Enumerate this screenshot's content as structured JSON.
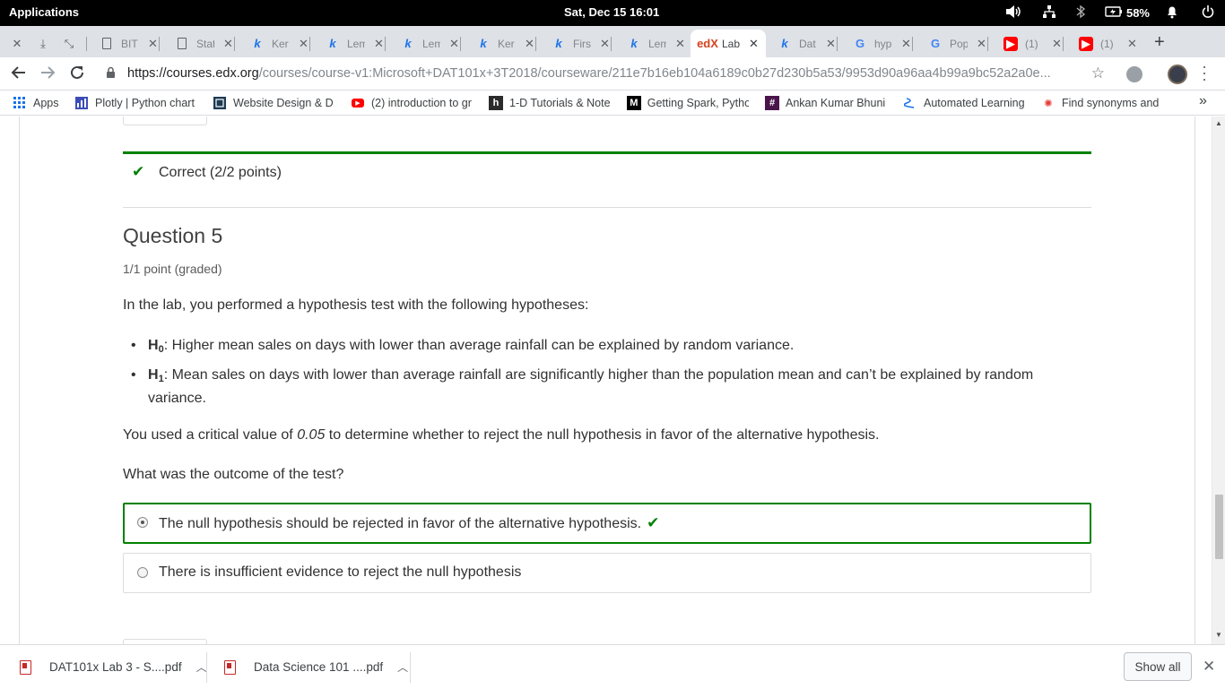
{
  "system": {
    "apps_label": "Applications",
    "clock": "Sat, Dec 15   16:01",
    "battery": "58%",
    "icons": [
      "volume-icon",
      "network-icon",
      "bluetooth-icon",
      "battery-icon",
      "bell-icon",
      "power-icon"
    ]
  },
  "tabs": [
    {
      "icon": "close-icon",
      "label": ""
    },
    {
      "icon": "download-icon",
      "label": ""
    },
    {
      "icon": "collapse-icon",
      "label": ""
    },
    {
      "icon": "doc-icon",
      "label": "BIT"
    },
    {
      "icon": "doc-icon",
      "label": "Stat"
    },
    {
      "icon": "k-icon",
      "label": "Ker"
    },
    {
      "icon": "k-icon",
      "label": "Lem"
    },
    {
      "icon": "k-icon",
      "label": "Lem"
    },
    {
      "icon": "k-icon",
      "label": "Ker"
    },
    {
      "icon": "k-icon",
      "label": "Firs"
    },
    {
      "icon": "k-icon",
      "label": "Lem"
    },
    {
      "icon": "edx-icon",
      "label": "Lab",
      "active": true
    },
    {
      "icon": "k-icon",
      "label": "Dat"
    },
    {
      "icon": "google-icon",
      "label": "hyp"
    },
    {
      "icon": "google-icon",
      "label": "Pop"
    },
    {
      "icon": "youtube-icon",
      "label": "(1)"
    },
    {
      "icon": "youtube-icon",
      "label": "(1)"
    }
  ],
  "toolbar": {
    "url_host": "https://courses.edx.org",
    "url_path": "/courses/course-v1:Microsoft+DAT101x+3T2018/courseware/211e7b16eb104a6189c0b27d230b5a53/9953d90a96aa4b99a9bc52a2a0e..."
  },
  "bookmarks": [
    {
      "icon": "apps-icon",
      "label": "Apps"
    },
    {
      "icon": "plotly-icon",
      "label": "Plotly | Python chart"
    },
    {
      "icon": "webdesign-icon",
      "label": "Website Design & D"
    },
    {
      "icon": "youtube-icon",
      "label": "(2) introduction to gr"
    },
    {
      "icon": "h-icon",
      "label": "1-D Tutorials & Note"
    },
    {
      "icon": "medium-icon",
      "label": "Getting Spark, Pytho"
    },
    {
      "icon": "slack-icon",
      "label": "Ankan Kumar Bhuni"
    },
    {
      "icon": "automl-icon",
      "label": "Automated Learning"
    },
    {
      "icon": "synonym-icon",
      "label": "Find synonyms and"
    }
  ],
  "content": {
    "prev_result": "Correct (2/2 points)",
    "question_title": "Question 5",
    "points": "1/1 point (graded)",
    "intro": "In the lab, you performed a hypothesis test with the following hypotheses:",
    "h0_label": "H",
    "h0_sub": "0",
    "h0_text": ": Higher mean sales on days with lower than average rainfall can be explained by random variance.",
    "h1_label": "H",
    "h1_sub": "1",
    "h1_text": ": Mean sales on days with lower than average rainfall are significantly higher than the population mean and can’t be explained by random variance.",
    "crit_before": "You used a critical value of ",
    "crit_value": "0.05",
    "crit_after": " to determine whether to reject the null hypothesis in favor of the alternative hypothesis.",
    "ask": "What was the outcome of the test?",
    "options": [
      {
        "text": "The null hypothesis should be rejected in favor of the alternative hypothesis.",
        "selected": true,
        "correct": true
      },
      {
        "text": "There is insufficient evidence to reject the null hypothesis",
        "selected": false
      }
    ]
  },
  "downloads": [
    {
      "name": "DAT101x Lab 3 - S....pdf"
    },
    {
      "name": "Data Science 101 ....pdf"
    }
  ],
  "shelf": {
    "show_all": "Show all"
  },
  "colors": {
    "correct_green": "#008100",
    "system_bar": "#000000",
    "tab_strip": "#dee1e6"
  }
}
